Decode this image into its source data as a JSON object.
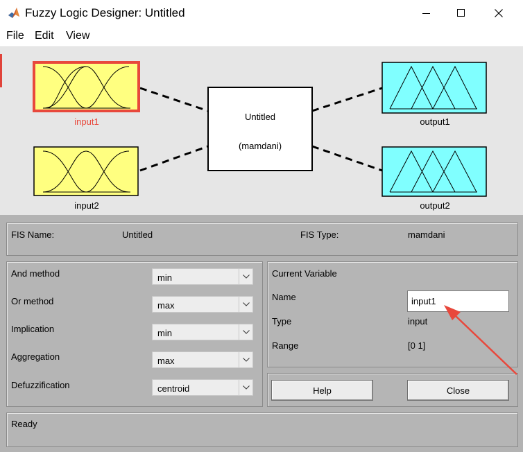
{
  "window": {
    "title": "Fuzzy Logic Designer: Untitled",
    "app_icon": "matlab-icon",
    "controls": [
      "minimize-icon",
      "maximize-icon",
      "close-icon"
    ]
  },
  "menu": {
    "file": "File",
    "edit": "Edit",
    "view": "View"
  },
  "diagram": {
    "inputs": [
      {
        "label": "input1",
        "selected": true,
        "color": "#ffff80"
      },
      {
        "label": "input2",
        "selected": false,
        "color": "#ffff80"
      }
    ],
    "system": {
      "name": "Untitled",
      "type": "(mamdani)"
    },
    "outputs": [
      {
        "label": "output1",
        "color": "#80ffff"
      },
      {
        "label": "output2",
        "color": "#80ffff"
      }
    ],
    "selected_color": "#e8483c"
  },
  "fis": {
    "name_label": "FIS Name:",
    "name_value": "Untitled",
    "type_label": "FIS Type:",
    "type_value": "mamdani"
  },
  "methods": [
    {
      "label": "And method",
      "value": "min"
    },
    {
      "label": "Or method",
      "value": "max"
    },
    {
      "label": "Implication",
      "value": "min"
    },
    {
      "label": "Aggregation",
      "value": "max"
    },
    {
      "label": "Defuzzification",
      "value": "centroid"
    }
  ],
  "current_variable": {
    "heading": "Current Variable",
    "name_label": "Name",
    "name_value": "input1",
    "type_label": "Type",
    "type_value": "input",
    "range_label": "Range",
    "range_value": "[0 1]"
  },
  "buttons": {
    "help": "Help",
    "close": "Close"
  },
  "status": {
    "text": "Ready"
  },
  "annotation": {
    "arrow_color": "#e8483c"
  }
}
